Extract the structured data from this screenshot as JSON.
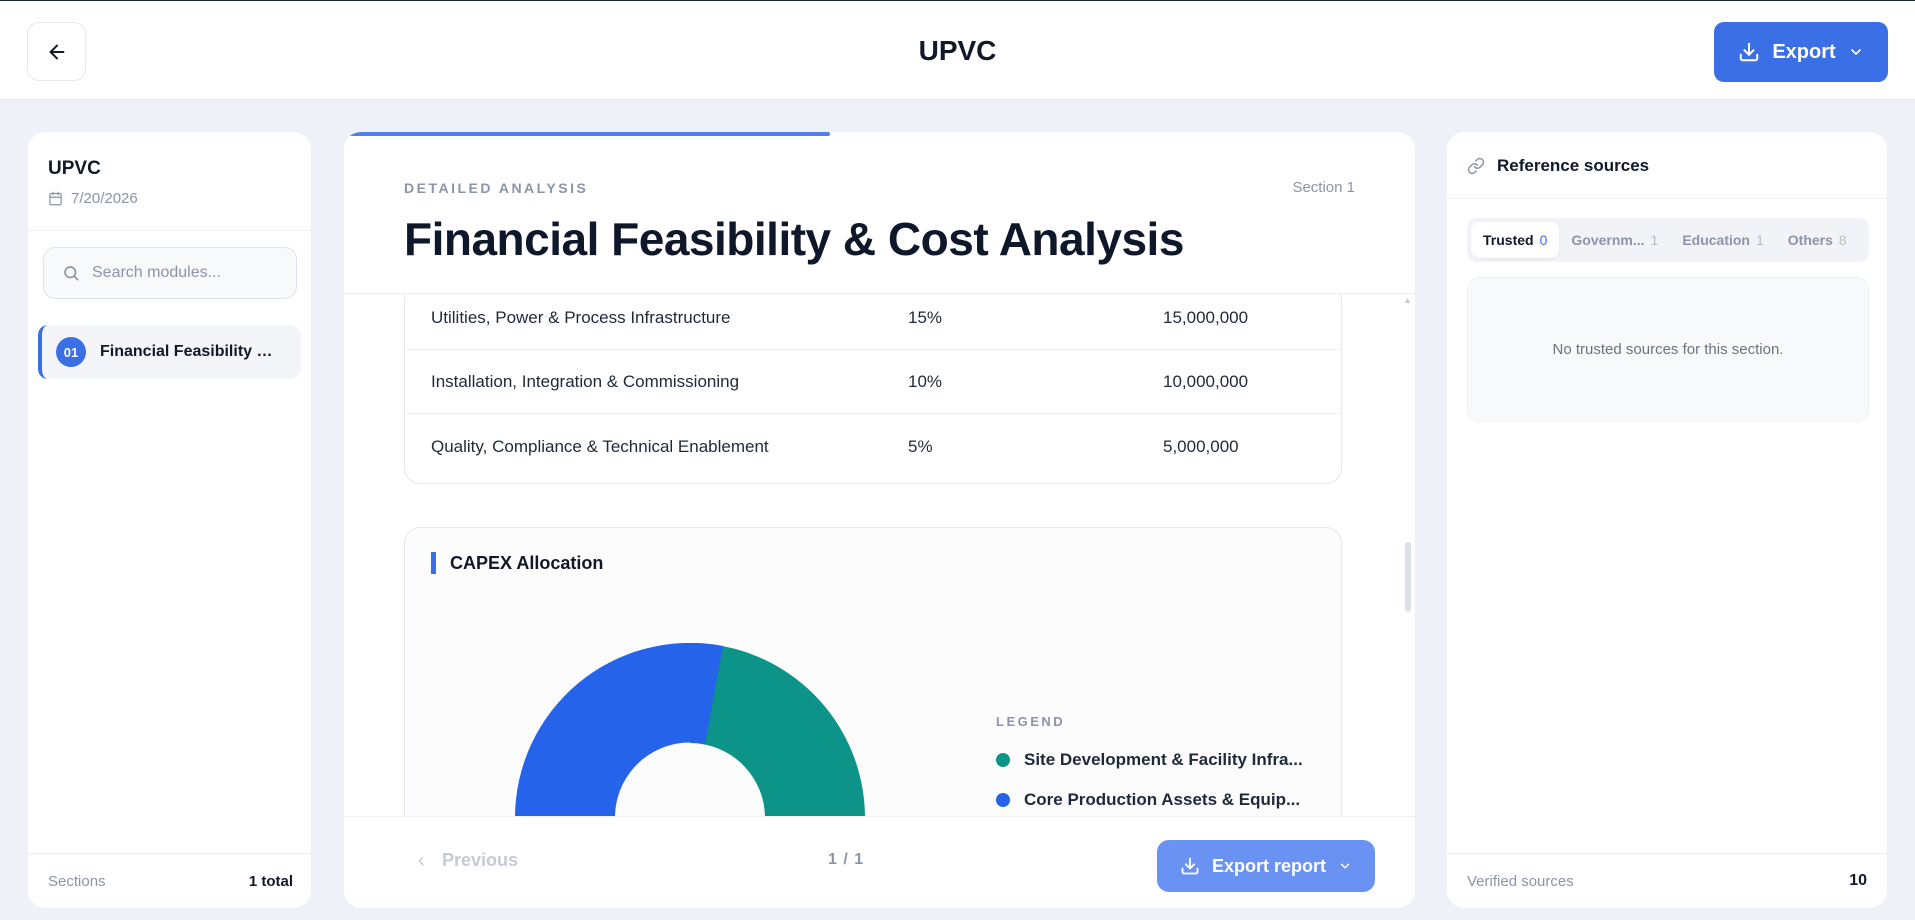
{
  "header": {
    "title": "UPVC",
    "export_label": "Export"
  },
  "sidebar": {
    "title": "UPVC",
    "date": "7/20/2026",
    "search_placeholder": "Search modules...",
    "modules": [
      {
        "number": "01",
        "label": "Financial Feasibility & ..."
      }
    ],
    "footer_label": "Sections",
    "footer_count": "1 total"
  },
  "main": {
    "eyebrow": "DETAILED ANALYSIS",
    "section_tag": "Section 1",
    "heading": "Financial Feasibility & Cost Analysis",
    "progress": 0.45,
    "table": {
      "rows": [
        [
          "Utilities, Power & Process Infrastructure",
          "15%",
          "15,000,000"
        ],
        [
          "Installation, Integration & Commissioning",
          "10%",
          "10,000,000"
        ],
        [
          "Quality, Compliance & Technical Enablement",
          "5%",
          "5,000,000"
        ]
      ]
    },
    "chart_title": "CAPEX Allocation",
    "legend_title": "LEGEND",
    "footer": {
      "previous_label": "Previous",
      "page_indicator": "1 / 1",
      "export_report_label": "Export report"
    }
  },
  "chart_data": {
    "type": "pie",
    "title": "CAPEX Allocation",
    "legend": [
      {
        "name": "Site Development & Facility Infra...",
        "color": "#0d9488"
      },
      {
        "name": "Core Production Assets & Equip...",
        "color": "#2563eb"
      }
    ],
    "colors": [
      "#0d9488",
      "#2563eb"
    ]
  },
  "references": {
    "title": "Reference sources",
    "tabs": [
      {
        "label": "Trusted",
        "count": "0"
      },
      {
        "label": "Governm...",
        "count": "1"
      },
      {
        "label": "Education",
        "count": "1"
      },
      {
        "label": "Others",
        "count": "8"
      }
    ],
    "empty_message": "No trusted sources for this section.",
    "footer_label": "Verified sources",
    "footer_count": "10"
  }
}
